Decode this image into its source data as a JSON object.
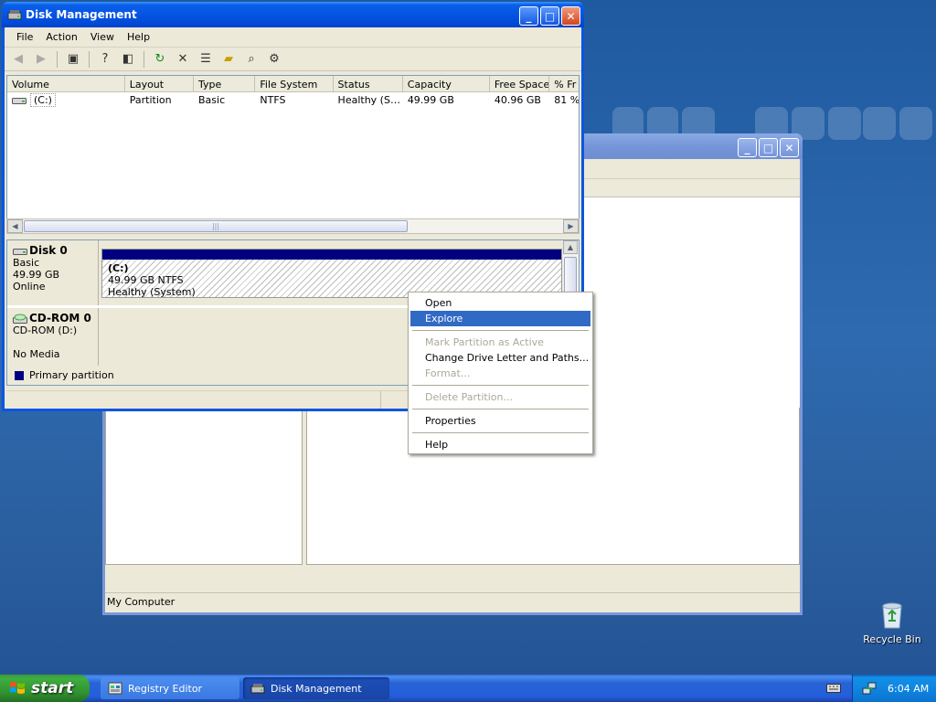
{
  "desktop": {
    "recycle_bin_label": "Recycle Bin"
  },
  "bg_window": {
    "status_text": "My Computer"
  },
  "disk_mgmt": {
    "title": "Disk Management",
    "menu": [
      "File",
      "Action",
      "View",
      "Help"
    ],
    "columns": [
      "Volume",
      "Layout",
      "Type",
      "File System",
      "Status",
      "Capacity",
      "Free Space",
      "% Fr"
    ],
    "volumes": [
      {
        "volume": "(C:)",
        "layout": "Partition",
        "type": "Basic",
        "fs": "NTFS",
        "status": "Healthy (S…",
        "capacity": "49.99 GB",
        "free": "40.96 GB",
        "pct": "81 %"
      }
    ],
    "disks": [
      {
        "name": "Disk 0",
        "line1": "Basic",
        "line2": "49.99 GB",
        "line3": "Online"
      },
      {
        "name": "CD-ROM 0",
        "line1": "CD-ROM (D:)",
        "line2": "",
        "line3": "No Media"
      }
    ],
    "partition": {
      "label": "(C:)",
      "size": "49.99 GB NTFS",
      "status": "Healthy (System)"
    },
    "legend": "Primary partition"
  },
  "context_menu": {
    "items": [
      {
        "label": "Open",
        "state": "normal"
      },
      {
        "label": "Explore",
        "state": "selected"
      },
      {
        "label": "Mark Partition as Active",
        "state": "disabled"
      },
      {
        "label": "Change Drive Letter and Paths...",
        "state": "normal"
      },
      {
        "label": "Format...",
        "state": "disabled"
      },
      {
        "label": "Delete Partition...",
        "state": "disabled"
      },
      {
        "label": "Properties",
        "state": "normal"
      },
      {
        "label": "Help",
        "state": "normal"
      }
    ]
  },
  "taskbar": {
    "start_label": "start",
    "tasks": [
      {
        "label": "Registry Editor",
        "active": false
      },
      {
        "label": "Disk Management",
        "active": true
      }
    ],
    "clock": "6:04 AM"
  },
  "colors": {
    "primary_partition": "#000080",
    "menu_highlight": "#316ac5",
    "xp_title_blue": "#0554e3"
  }
}
